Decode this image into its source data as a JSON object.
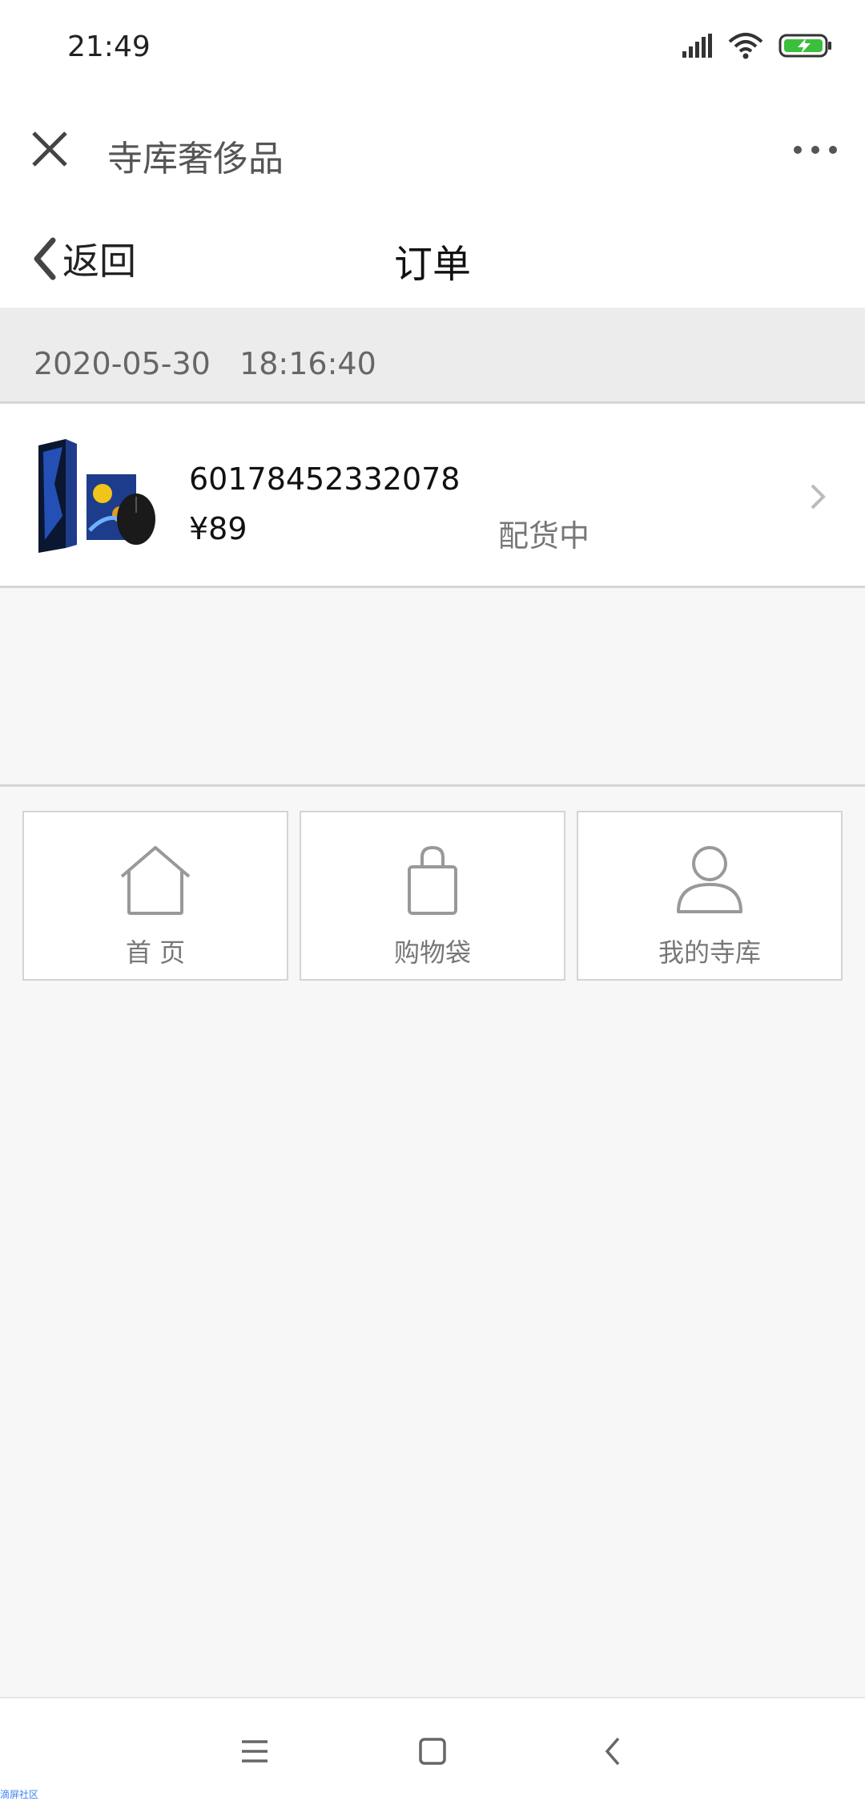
{
  "status_bar": {
    "time": "21:49",
    "icons": [
      "signal-icon",
      "wifi-icon",
      "battery-charging-icon"
    ],
    "battery_color": "#3cbf3c"
  },
  "app_header": {
    "title": "寺库奢侈品",
    "close_icon": "close-icon",
    "more_icon": "more-icon"
  },
  "page_nav": {
    "back_label": "返回",
    "title": "订单"
  },
  "order_group": {
    "date": "2020-05-30   18:16:40",
    "orders": [
      {
        "order_id": "60178452332078",
        "price": "¥89",
        "status": "配货中",
        "thumbnail": "product-thumbnail"
      }
    ]
  },
  "bottom_nav": {
    "items": [
      {
        "label": "首 页",
        "icon": "home-icon"
      },
      {
        "label": "购物袋",
        "icon": "shopping-bag-icon"
      },
      {
        "label": "我的寺库",
        "icon": "user-icon"
      }
    ]
  },
  "system_nav": {
    "buttons": [
      "menu-icon",
      "home-square-icon",
      "back-icon"
    ]
  },
  "watermark": "滴屏社区",
  "colors": {
    "background": "#f7f7f7",
    "divider": "#d6d6d6",
    "muted_text": "#777777"
  }
}
